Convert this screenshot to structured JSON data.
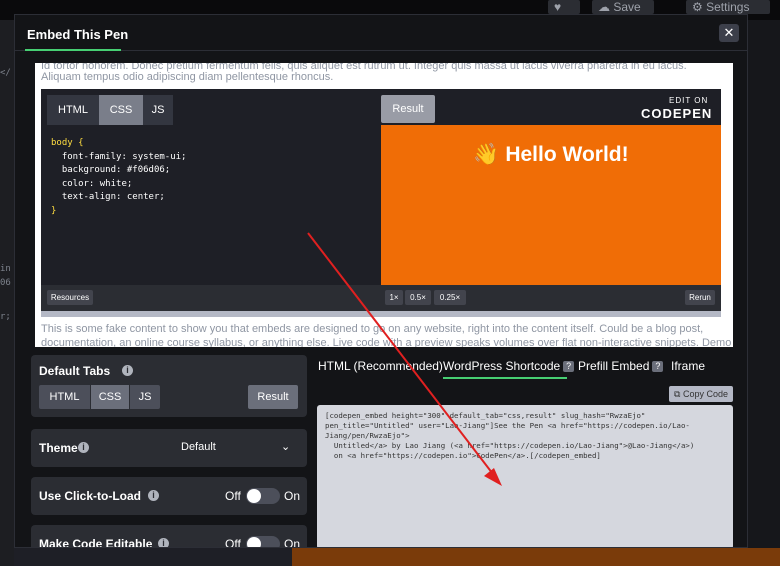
{
  "background": {
    "favorite_label": "♥",
    "save_label": "Save",
    "settings_label": "Settings"
  },
  "modal": {
    "title": "Embed This Pen",
    "close_label": "✕"
  },
  "preview": {
    "fake_text_top1": "Id tortor nonorem. Donec pretium fermentum felis, quis aliquet est rutrum ut. Integer quis massa ut lacus viverra pharetra in eu lacus.",
    "fake_text_top2": "Aliquam tempus odio adipiscing diam pellentesque rhoncus.",
    "fake_text_bottom1": "This is some fake content to show you that embeds are designed to go on any website, right into the content itself. Could be a blog post,",
    "fake_text_bottom2": "documentation, an online course syllabus, or anything else. Live code with a preview speaks volumes over flat non-interactive snippets. Demo",
    "tabs": [
      "HTML",
      "CSS",
      "JS"
    ],
    "result_label": "Result",
    "edit_on": "EDIT ON",
    "codepen_logo": "CODEPEN",
    "code_lines": [
      "body {",
      "  font-family: system-ui;",
      "  background: #f06d06;",
      "  color: white;",
      "  text-align: center;",
      "}"
    ],
    "hello": "👋 Hello World!",
    "resources_label": "Resources",
    "zoom_options": [
      "1×",
      "0.5×",
      "0.25×"
    ],
    "rerun_label": "Rerun"
  },
  "options": {
    "default_tabs": {
      "label": "Default Tabs",
      "tabs": [
        "HTML",
        "CSS",
        "JS"
      ],
      "result_label": "Result"
    },
    "theme": {
      "label": "Theme",
      "value": "Default"
    },
    "click_to_load": {
      "label": "Use Click-to-Load",
      "off": "Off",
      "on": "On"
    },
    "editable": {
      "label": "Make Code Editable",
      "off": "Off",
      "on": "On"
    }
  },
  "embed_types": {
    "tabs": [
      "HTML (Recommended)",
      "WordPress Shortcode",
      "Prefill Embed",
      "Iframe"
    ],
    "copy_label": "Copy Code",
    "code": "[codepen_embed height=\"300\" default_tab=\"css,result\" slug_hash=\"RwzaEjo\"\npen_title=\"Untitled\" user=\"Lao-Jiang\"]See the Pen <a href=\"https://codepen.io/Lao-\nJiang/pen/RwzaEjo\">\n  Untitled</a> by Lao Jiang (<a href=\"https://codepen.io/Lao-Jiang\">@Lao-Jiang</a>)\n  on <a href=\"https://codepen.io\">CodePen</a>.[/codepen_embed]"
  },
  "colors": {
    "accent": "#47cf73",
    "result_bg": "#f06d06",
    "annotation_arrow": "#e02020"
  }
}
